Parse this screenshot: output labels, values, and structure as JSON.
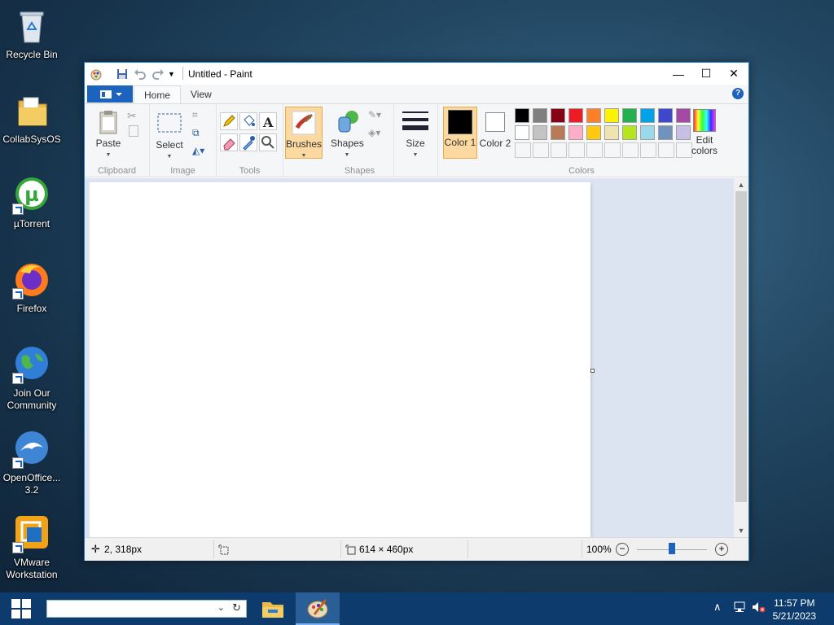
{
  "desktop": {
    "icons": [
      {
        "label": "Recycle Bin"
      },
      {
        "label": "CollabSysOS"
      },
      {
        "label": "µTorrent"
      },
      {
        "label": "Firefox"
      },
      {
        "label": "Join Our Community"
      },
      {
        "label": "OpenOffice... 3.2"
      },
      {
        "label": "VMware Workstation"
      }
    ]
  },
  "window": {
    "title": "Untitled - Paint",
    "controls": {
      "minimize": "—",
      "maximize": "☐",
      "close": "✕"
    }
  },
  "ribbon": {
    "tabs": [
      {
        "label": "Home"
      },
      {
        "label": "View"
      }
    ],
    "groups": {
      "clipboard": {
        "label": "Clipboard",
        "paste": "Paste"
      },
      "image": {
        "label": "Image",
        "select": "Select"
      },
      "tools": {
        "label": "Tools"
      },
      "brushes": {
        "label": "Brushes"
      },
      "shapes": {
        "label": "Shapes",
        "shapes_btn": "Shapes"
      },
      "size": {
        "label": "Size"
      },
      "colors": {
        "label": "Colors",
        "color1": "Color 1",
        "color2": "Color 2",
        "edit": "Edit colors",
        "color1_value": "#000000",
        "color2_value": "#ffffff",
        "palette_row1": [
          "#000000",
          "#7f7f7f",
          "#880015",
          "#ed1c24",
          "#ff7f27",
          "#fff200",
          "#22b14c",
          "#00a2e8",
          "#3f48cc",
          "#a349a4"
        ],
        "palette_row2": [
          "#ffffff",
          "#c3c3c3",
          "#b97a57",
          "#ffaec9",
          "#ffc90e",
          "#efe4b0",
          "#b5e61d",
          "#99d9ea",
          "#7092be",
          "#c8bfe7"
        ]
      }
    }
  },
  "statusbar": {
    "cursor_pos": "2, 318px",
    "image_size": "614 × 460px",
    "zoom": "100%",
    "zoom_fraction": 0.5
  },
  "taskbar": {
    "time": "11:57 PM",
    "date": "5/21/2023"
  }
}
